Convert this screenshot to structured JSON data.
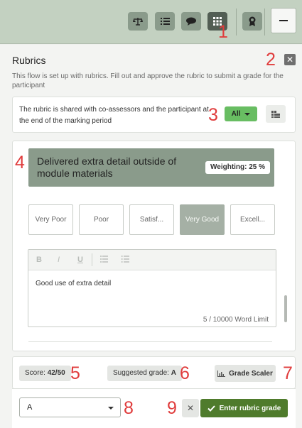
{
  "toolbar": {
    "icons": [
      "scale-icon",
      "list-icon",
      "chat-icon",
      "grid-icon",
      "award-icon",
      "minimize-icon"
    ],
    "active": "grid-icon"
  },
  "annotations": [
    "1",
    "2",
    "3",
    "4",
    "5",
    "6",
    "7",
    "8",
    "9"
  ],
  "panel": {
    "title": "Rubrics",
    "description": "This flow is set up with rubrics. Fill out and approve the rubric to submit a grade for the participant"
  },
  "sharing": {
    "text": "The rubric is shared with co-assessors and the participant at the end of the marking period",
    "filter_label": "All"
  },
  "criterion": {
    "title": "Delivered extra detail outside of module materials",
    "weighting": "Weighting: 25 %",
    "levels": [
      {
        "label": "Very Poor",
        "selected": false
      },
      {
        "label": "Poor",
        "selected": false
      },
      {
        "label": "Satisf...",
        "selected": false
      },
      {
        "label": "Very Good",
        "selected": true
      },
      {
        "label": "Excell...",
        "selected": false
      }
    ]
  },
  "editor": {
    "tools": [
      "B",
      "I",
      "U"
    ],
    "content": "Good use of extra detail",
    "word_count": "5 / 10000 Word Limit"
  },
  "score": {
    "label": "Score:",
    "value": "42/50"
  },
  "suggested": {
    "label": "Suggested grade:",
    "value": "A"
  },
  "grade_scaler_label": "Grade Scaler",
  "grade_select": {
    "value": "A"
  },
  "enter_button_label": "Enter rubric grade",
  "colors": {
    "accent": "#4f7b2c",
    "filter": "#68bd62",
    "criterion_bg": "#8a9b8b",
    "annotation": "#e03c3c"
  }
}
